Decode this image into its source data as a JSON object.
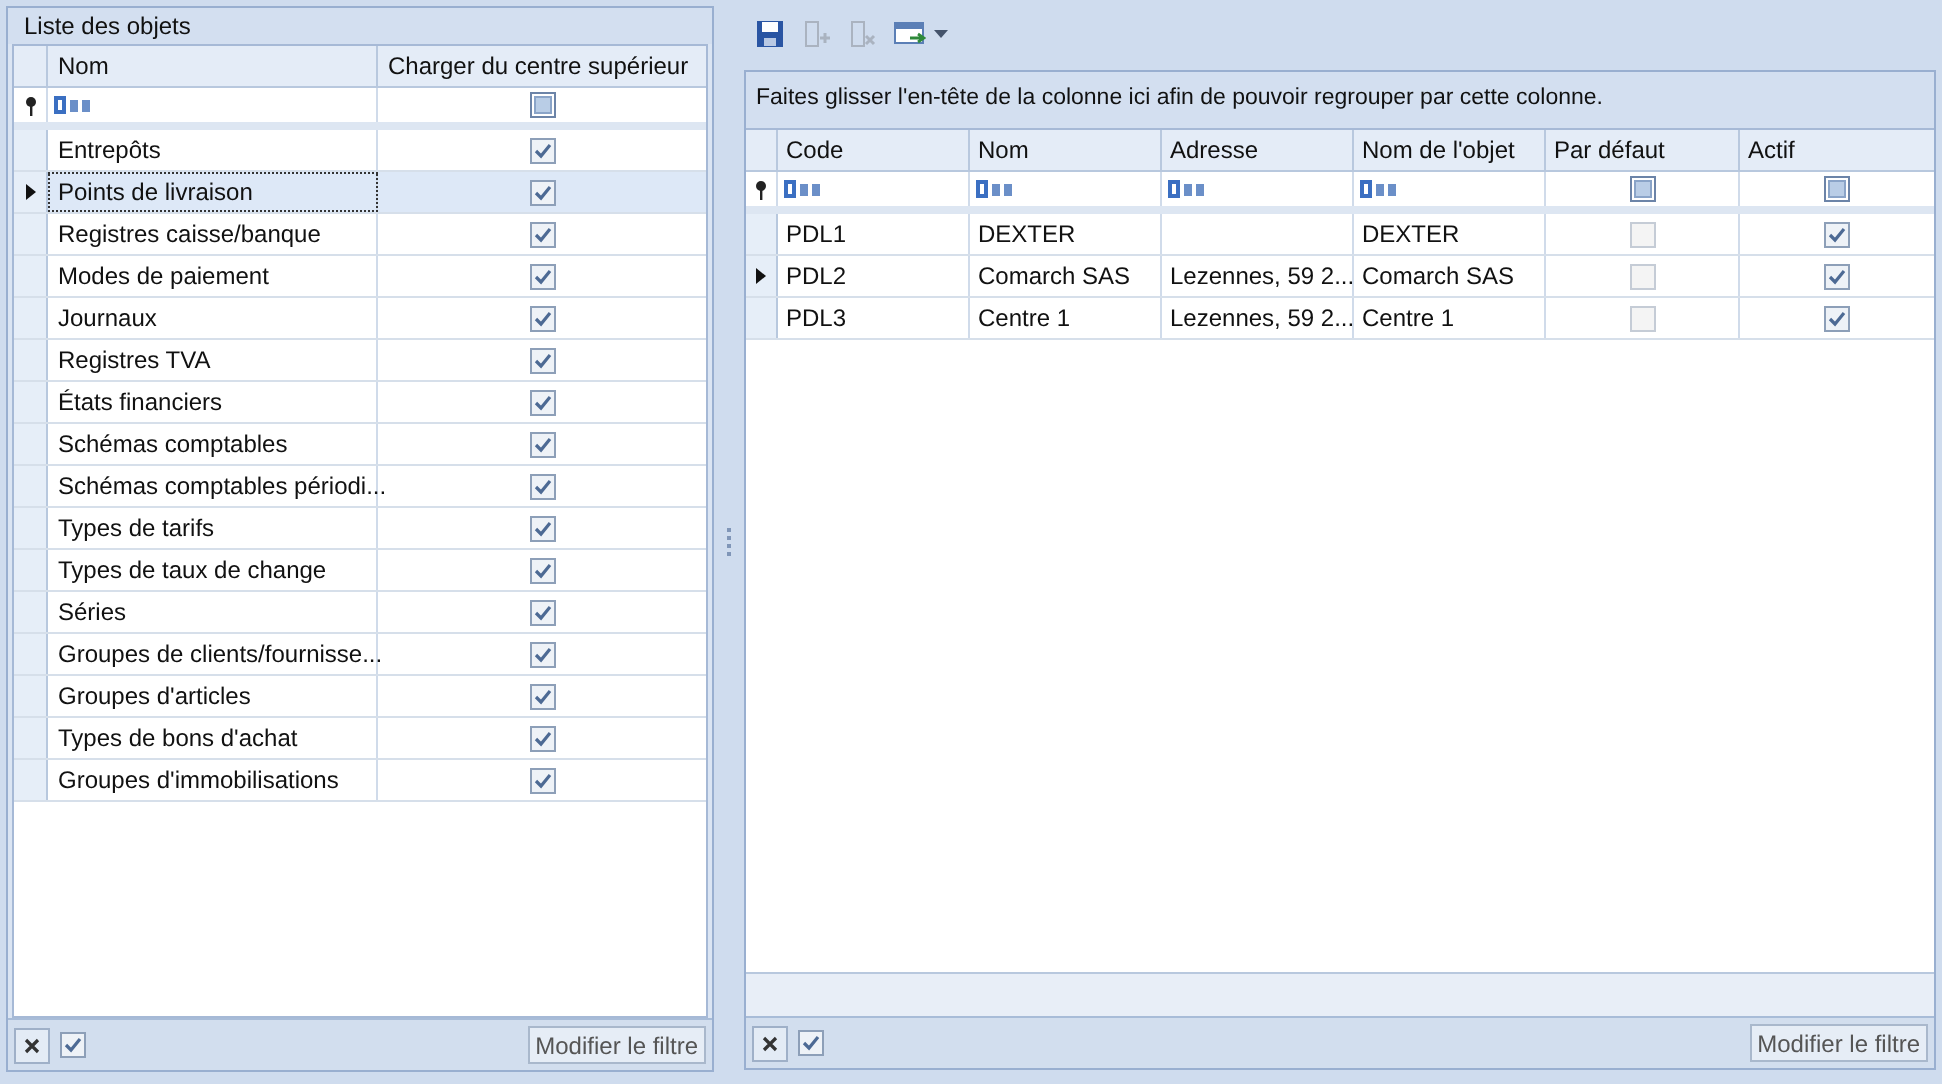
{
  "left_panel": {
    "title": "Liste des objets",
    "columns": [
      "Nom",
      "Charger du centre supérieur"
    ],
    "filter_indeterminate": true,
    "rows": [
      {
        "name": "Entrepôts",
        "checked": true,
        "selected": false
      },
      {
        "name": "Points de livraison",
        "checked": true,
        "selected": true
      },
      {
        "name": "Registres caisse/banque",
        "checked": true,
        "selected": false
      },
      {
        "name": "Modes de paiement",
        "checked": true,
        "selected": false
      },
      {
        "name": "Journaux",
        "checked": true,
        "selected": false
      },
      {
        "name": "Registres TVA",
        "checked": true,
        "selected": false
      },
      {
        "name": "États financiers",
        "checked": true,
        "selected": false
      },
      {
        "name": "Schémas comptables",
        "checked": true,
        "selected": false
      },
      {
        "name": "Schémas comptables périodi...",
        "checked": true,
        "selected": false
      },
      {
        "name": "Types de tarifs",
        "checked": true,
        "selected": false
      },
      {
        "name": "Types de taux de change",
        "checked": true,
        "selected": false
      },
      {
        "name": "Séries",
        "checked": true,
        "selected": false
      },
      {
        "name": "Groupes de clients/fournisse...",
        "checked": true,
        "selected": false
      },
      {
        "name": "Groupes d'articles",
        "checked": true,
        "selected": false
      },
      {
        "name": "Types de bons d'achat",
        "checked": true,
        "selected": false
      },
      {
        "name": "Groupes d'immobilisations",
        "checked": true,
        "selected": false
      }
    ],
    "footer": {
      "filter_checked": true,
      "button": "Modifier le filtre"
    }
  },
  "right_panel": {
    "group_hint": "Faites glisser l'en-tête de la colonne ici afin de pouvoir regrouper par cette colonne.",
    "columns": [
      "Code",
      "Nom",
      "Adresse",
      "Nom de l'objet",
      "Par défaut",
      "Actif"
    ],
    "default_filter_indeterminate": true,
    "active_filter_indeterminate": true,
    "rows": [
      {
        "code": "PDL1",
        "nom": "DEXTER",
        "adresse": "",
        "nom_objet": "DEXTER",
        "default": false,
        "active": true,
        "selected": false
      },
      {
        "code": "PDL2",
        "nom": "Comarch SAS",
        "adresse": "Lezennes, 59 2...",
        "nom_objet": "Comarch SAS",
        "default": false,
        "active": true,
        "selected": true
      },
      {
        "code": "PDL3",
        "nom": "Centre 1",
        "adresse": "Lezennes, 59 2...",
        "nom_objet": "Centre 1",
        "default": false,
        "active": true,
        "selected": false
      }
    ],
    "footer": {
      "filter_checked": true,
      "button": "Modifier le filtre"
    }
  }
}
